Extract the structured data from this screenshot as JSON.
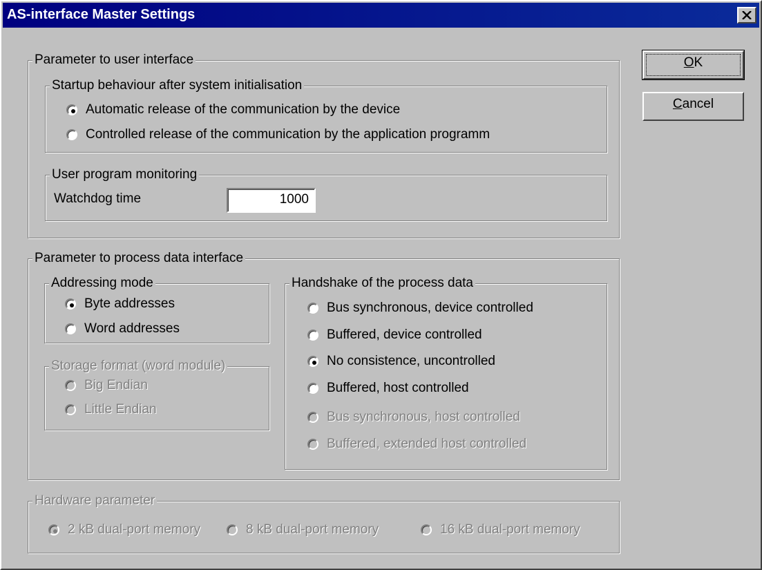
{
  "window": {
    "title": "AS-interface Master Settings"
  },
  "buttons": {
    "ok_label": "OK",
    "ok_mnemonic": "O",
    "ok_rest": "K",
    "cancel_label": "Cancel",
    "cancel_mnemonic": "C",
    "cancel_rest": "ancel"
  },
  "user_interface": {
    "legend": "Parameter to user interface",
    "startup": {
      "legend": "Startup behaviour after system initialisation",
      "options": [
        {
          "label": "Automatic release of the communication by the device",
          "selected": true
        },
        {
          "label": "Controlled release of the communication by the application programm",
          "selected": false
        }
      ]
    },
    "monitoring": {
      "legend": "User program monitoring",
      "watchdog_label": "Watchdog time",
      "watchdog_value": "1000"
    }
  },
  "process_data": {
    "legend": "Parameter to process data interface",
    "addressing": {
      "legend": "Addressing mode",
      "options": [
        {
          "label": "Byte addresses",
          "selected": true
        },
        {
          "label": "Word addresses",
          "selected": false
        }
      ]
    },
    "storage": {
      "legend": "Storage format (word module)",
      "options": [
        {
          "label": "Big Endian",
          "selected": false,
          "enabled": false
        },
        {
          "label": "Little Endian",
          "selected": false,
          "enabled": false
        }
      ]
    },
    "handshake": {
      "legend": "Handshake of the process data",
      "options": [
        {
          "label": "Bus synchronous, device controlled",
          "selected": false,
          "enabled": true
        },
        {
          "label": "Buffered, device controlled",
          "selected": false,
          "enabled": true
        },
        {
          "label": "No consistence, uncontrolled",
          "selected": true,
          "enabled": true
        },
        {
          "label": "Buffered, host controlled",
          "selected": false,
          "enabled": true
        },
        {
          "label": "Bus synchronous, host controlled",
          "selected": false,
          "enabled": false
        },
        {
          "label": "Buffered, extended host controlled",
          "selected": false,
          "enabled": false
        }
      ]
    }
  },
  "hardware": {
    "legend": "Hardware parameter",
    "options": [
      {
        "label": "2 kB dual-port memory",
        "selected": true,
        "enabled": false
      },
      {
        "label": "8 kB dual-port memory",
        "selected": false,
        "enabled": false
      },
      {
        "label": "16 kB dual-port memory",
        "selected": false,
        "enabled": false
      }
    ]
  }
}
